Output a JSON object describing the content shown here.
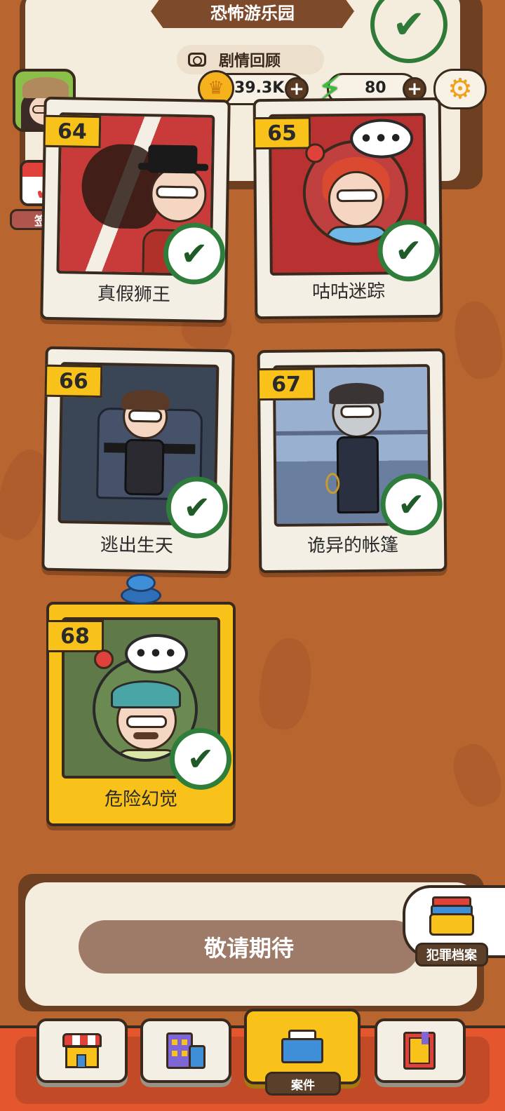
{
  "header": {
    "title": "恐怖游乐园",
    "story_review_label": "剧情回顾"
  },
  "currency": {
    "coins": "39.3K",
    "energy": "80",
    "coin_plus": "+",
    "energy_plus": "+"
  },
  "checkin": {
    "label": "签到"
  },
  "cases": [
    {
      "number": "64",
      "title": "真假狮王",
      "completed": true
    },
    {
      "number": "65",
      "title": "咕咕迷踪",
      "completed": true
    },
    {
      "number": "66",
      "title": "逃出生天",
      "completed": true
    },
    {
      "number": "67",
      "title": "诡异的帐篷",
      "completed": true
    },
    {
      "number": "68",
      "title": "危险幻觉",
      "completed": true,
      "selected": true
    }
  ],
  "speech_dots": "•••",
  "coming_soon": "敬请期待",
  "archive": {
    "label": "犯罪档案"
  },
  "bottom_nav": {
    "active_label": "案件",
    "items": [
      "shop-icon",
      "building-icon",
      "mail-icon",
      "book-icon"
    ]
  },
  "colors": {
    "background": "#b8652f",
    "accent_yellow": "#f8c21b",
    "check_green": "#2e7d3a",
    "nav_red": "#e4572e"
  }
}
